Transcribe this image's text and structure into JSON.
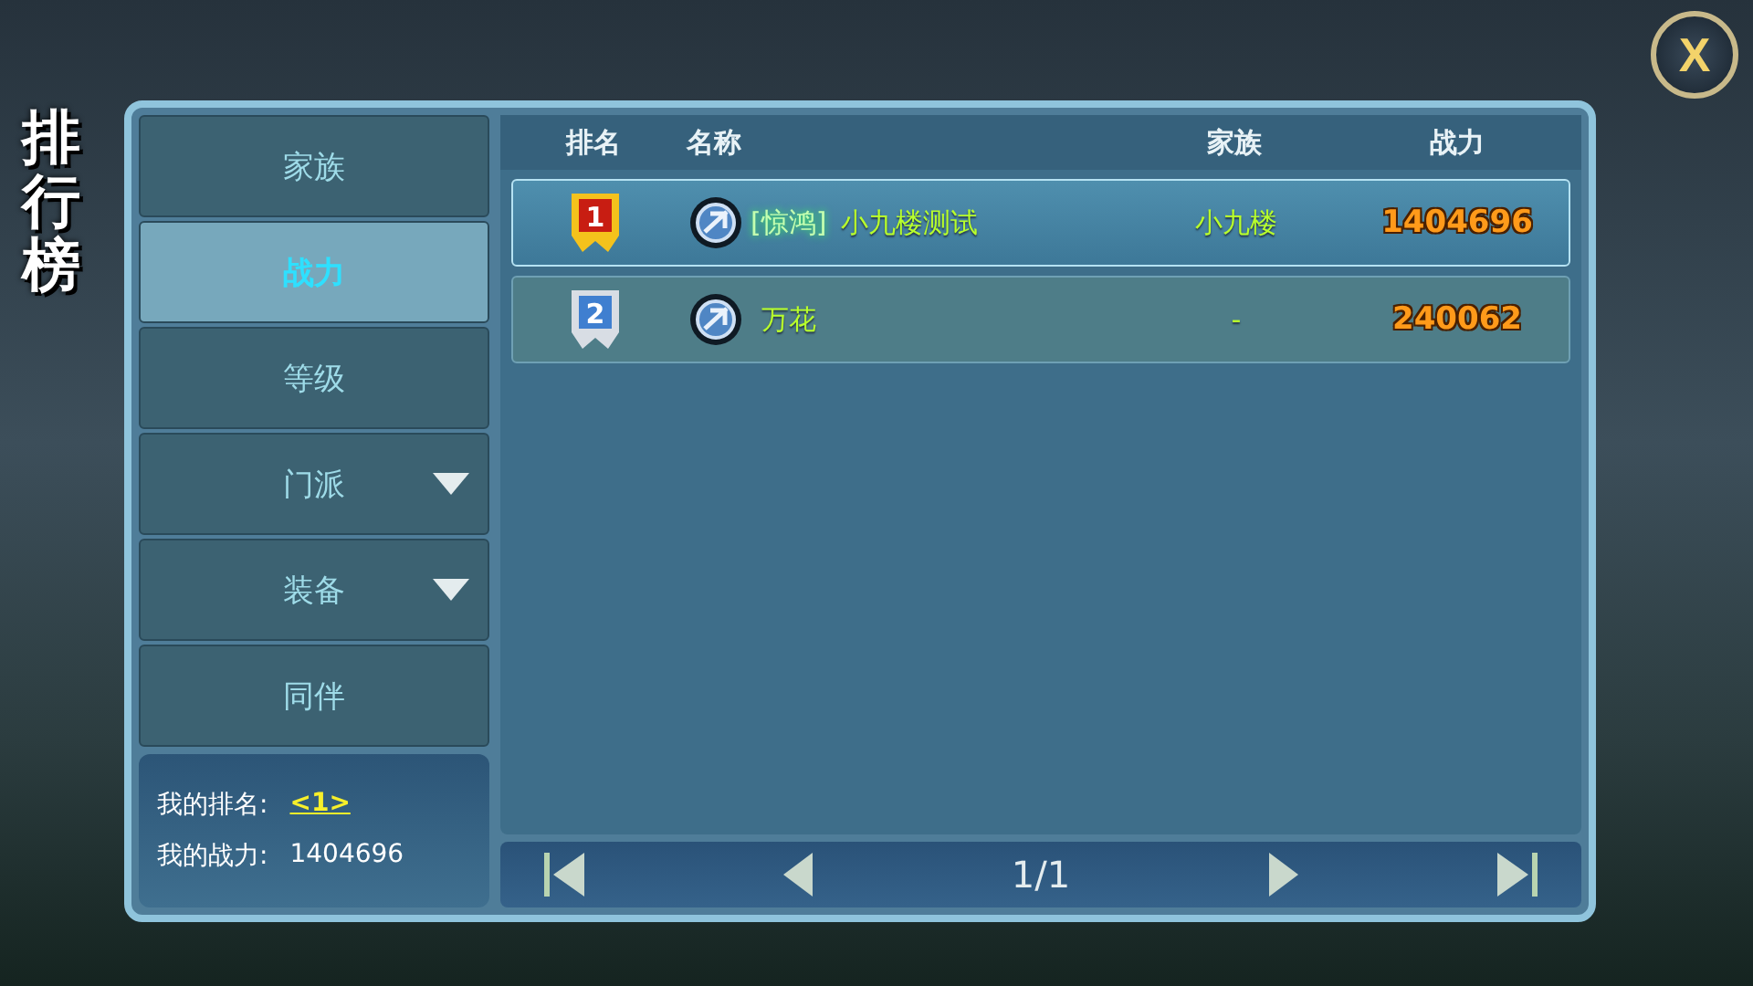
{
  "title": "排行榜",
  "close_button": {
    "label": "X"
  },
  "tabs": [
    {
      "label": "家族",
      "kind": "plain",
      "selected": false
    },
    {
      "label": "战力",
      "kind": "plain",
      "selected": true
    },
    {
      "label": "等级",
      "kind": "plain",
      "selected": false
    },
    {
      "label": "门派",
      "kind": "dropdown",
      "selected": false
    },
    {
      "label": "装备",
      "kind": "dropdown",
      "selected": false
    },
    {
      "label": "同伴",
      "kind": "plain",
      "selected": false
    }
  ],
  "my_summary": {
    "rank_label": "我的排名:",
    "rank_value": "<1>",
    "power_label": "我的战力:",
    "power_value": "1404696"
  },
  "table": {
    "columns": [
      "排名",
      "名称",
      "家族",
      "战力"
    ],
    "rows": [
      {
        "rank": "1",
        "kind": "gold",
        "tag": "[惊鸿]",
        "name": "小九楼测试",
        "family": "小九楼",
        "power": "1404696",
        "selected": true
      },
      {
        "rank": "2",
        "kind": "silver",
        "name": "万花",
        "family": "-",
        "power": "240062",
        "selected": false
      }
    ]
  },
  "pager": {
    "page": "1/1"
  }
}
